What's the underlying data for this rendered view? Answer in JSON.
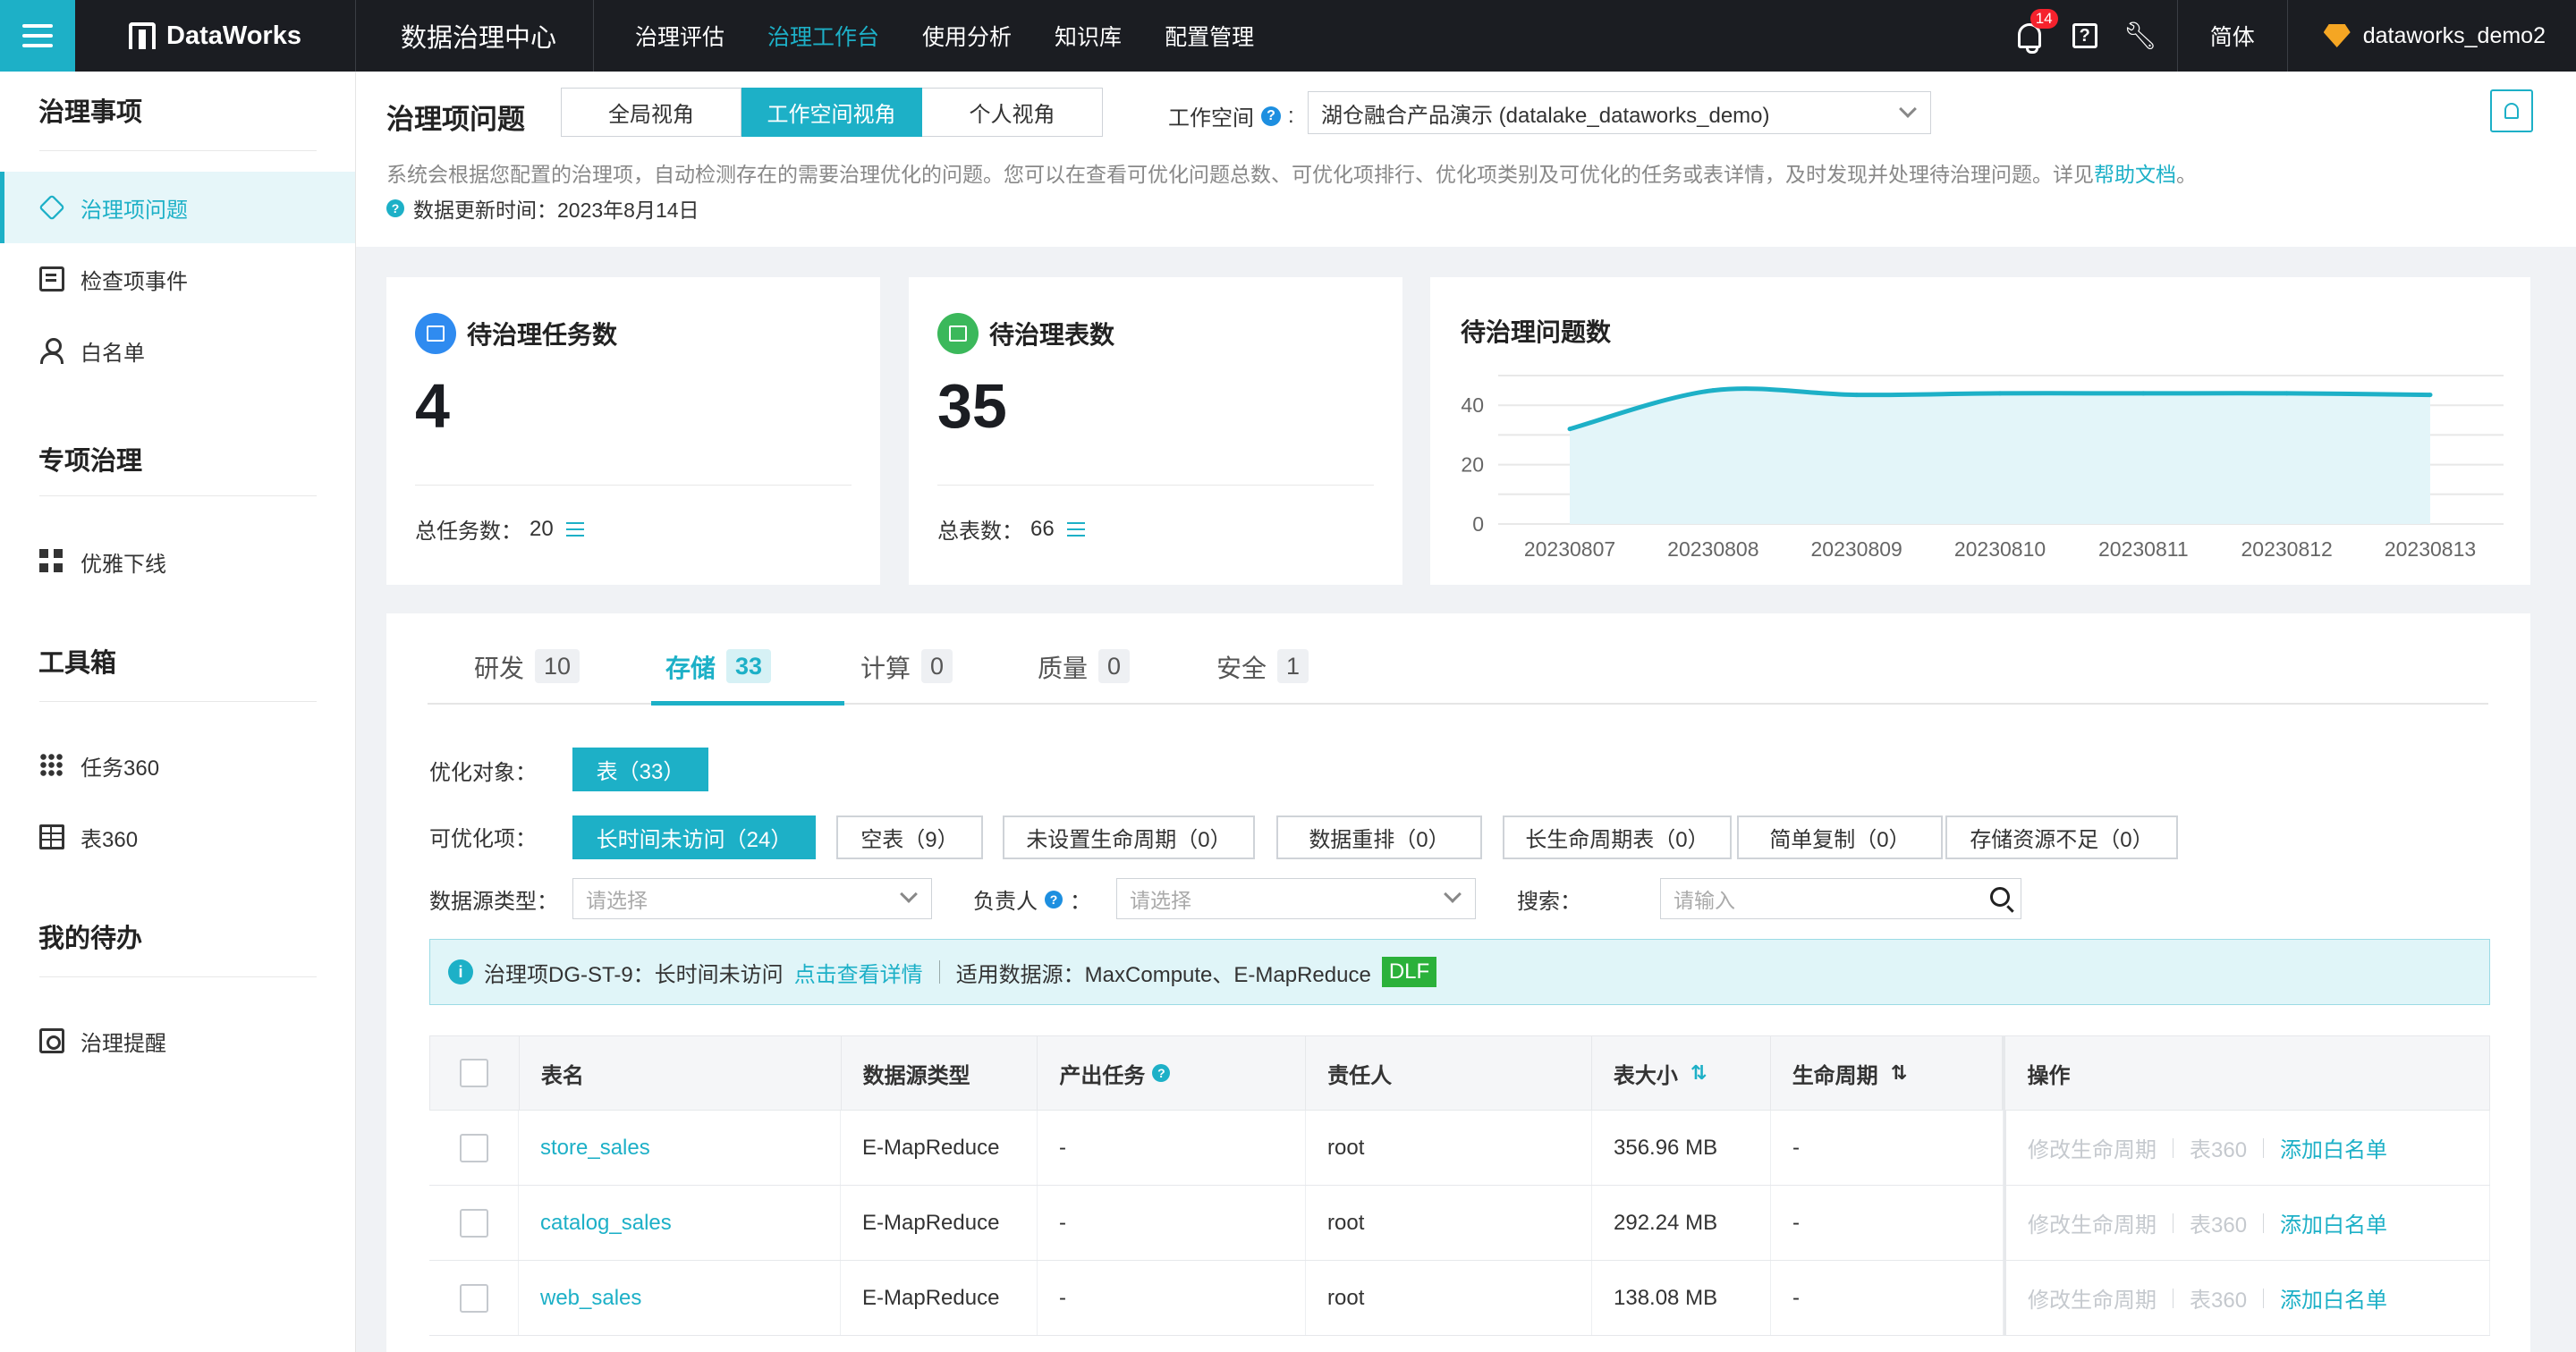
{
  "app": {
    "brand": "DataWorks",
    "center_title": "数据治理中心",
    "nav": [
      "治理评估",
      "治理工作台",
      "使用分析",
      "知识库",
      "配置管理"
    ],
    "nav_active": "治理工作台",
    "notification_count": "14",
    "help_label": "?",
    "language": "简体",
    "username": "dataworks_demo2",
    "accent_color": "#1db0c7"
  },
  "sidebar": {
    "group1": "治理事项",
    "item_issues": "治理项问题",
    "item_events": "检查项事件",
    "item_whitelist": "白名单",
    "group2": "专项治理",
    "item_offline": "优雅下线",
    "group3": "工具箱",
    "item_task360": "任务360",
    "item_table360": "表360",
    "group4": "我的待办",
    "item_remind": "治理提醒"
  },
  "header": {
    "title": "治理项问题",
    "views": [
      "全局视角",
      "工作空间视角",
      "个人视角"
    ],
    "active_view": "工作空间视角",
    "workspace_label": "工作空间",
    "workspace_value": "湖仓融合产品演示 (datalake_dataworks_demo)",
    "description": "系统会根据您配置的治理项，自动检测存在的需要治理优化的问题。您可以在查看可优化问题总数、可优化项排行、优化项类别及可优化的任务或表详情，及时发现并处理待治理问题。详见",
    "help_doc_link": "帮助文档",
    "description_end": "。",
    "update_time": "数据更新时间：2023年8月14日"
  },
  "cards": {
    "tasks": {
      "title": "待治理任务数",
      "value": "4",
      "total_label": "总任务数：",
      "total_value": "20"
    },
    "tables": {
      "title": "待治理表数",
      "value": "35",
      "total_label": "总表数：",
      "total_value": "66"
    }
  },
  "chart_data": {
    "type": "area",
    "title": "待治理问题数",
    "x": [
      "20230807",
      "20230808",
      "20230809",
      "20230810",
      "20230811",
      "20230812",
      "20230813"
    ],
    "series": [
      {
        "values": [
          32,
          45,
          43.5,
          44,
          44,
          44,
          43.5
        ]
      }
    ],
    "ylim": [
      0,
      50
    ],
    "yticks": [
      0,
      20,
      40
    ],
    "grid": true,
    "color": "#1db0c7"
  },
  "categories": [
    {
      "label": "研发",
      "count": "10"
    },
    {
      "label": "存储",
      "count": "33"
    },
    {
      "label": "计算",
      "count": "0"
    },
    {
      "label": "质量",
      "count": "0"
    },
    {
      "label": "安全",
      "count": "1"
    }
  ],
  "active_category": "存储",
  "filters": {
    "target_label": "优化对象：",
    "target_chip": "表（33）",
    "items_label": "可优化项：",
    "items": [
      "长时间未访问（24）",
      "空表（9）",
      "未设置生命周期（0）",
      "数据重排（0）",
      "长生命周期表（0）",
      "简单复制（0）",
      "存储资源不足（0）"
    ],
    "ds_type_label": "数据源类型：",
    "ds_type_placeholder": "请选择",
    "owner_label": "负责人",
    "owner_colon": "：",
    "owner_placeholder": "请选择",
    "search_label": "搜索：",
    "search_placeholder": "请输入"
  },
  "info": {
    "item_text": "治理项DG-ST-9：长时间未访问",
    "detail_link": "点击查看详情",
    "datasource_text": "适用数据源：MaxCompute、E-MapReduce",
    "dlf_badge": "DLF"
  },
  "table": {
    "headers": [
      "表名",
      "数据源类型",
      "产出任务",
      "责任人",
      "表大小",
      "生命周期",
      "操作"
    ],
    "rows": [
      {
        "name": "store_sales",
        "ds_type": "E-MapReduce",
        "task": "-",
        "owner": "root",
        "size": "356.96 MB",
        "lifecycle": "-"
      },
      {
        "name": "catalog_sales",
        "ds_type": "E-MapReduce",
        "task": "-",
        "owner": "root",
        "size": "292.24 MB",
        "lifecycle": "-"
      },
      {
        "name": "web_sales",
        "ds_type": "E-MapReduce",
        "task": "-",
        "owner": "root",
        "size": "138.08 MB",
        "lifecycle": "-"
      }
    ],
    "op_lifecycle": "修改生命周期",
    "op_table360": "表360",
    "op_whitelist": "添加白名单"
  }
}
